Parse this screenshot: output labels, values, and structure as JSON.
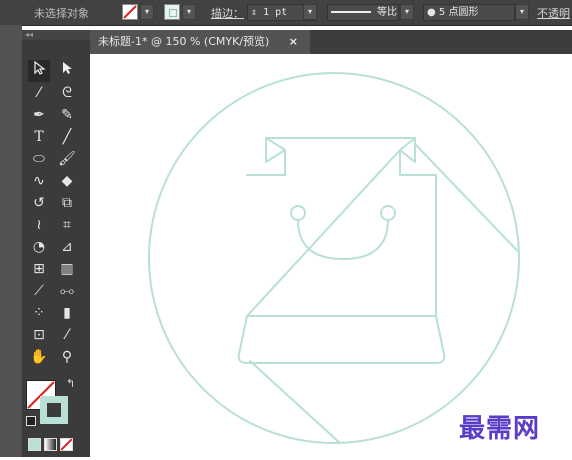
{
  "control_bar": {
    "no_selection": "未选择对象",
    "stroke_label": "描边：",
    "stroke_weight": "1 pt",
    "profile_label": "等比",
    "brush_label": "5 点圆形",
    "opacity_label": "不透明"
  },
  "document_tab": {
    "title": "未标题-1* @ 150 % (CMYK/预览)",
    "close": "×"
  },
  "toolbox": {
    "collapse": "◂◂"
  },
  "colors": {
    "artwork_stroke": "#b8e0d6",
    "ui_dark": "#424242",
    "fill_swatch": "#ffffff",
    "stroke_swatch": "#b8e0d6"
  },
  "watermark": "最需网"
}
